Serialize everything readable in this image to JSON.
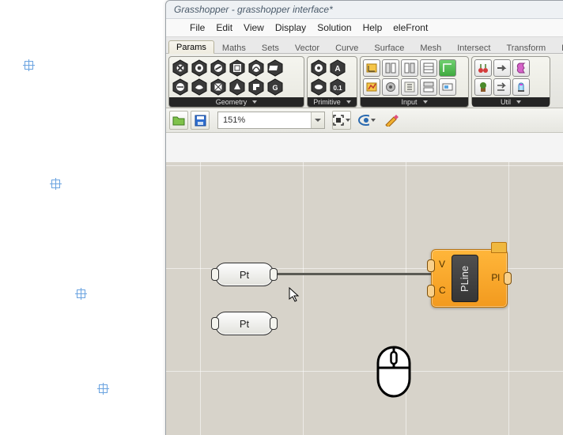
{
  "window": {
    "title": "Grasshopper - grasshopper interface*"
  },
  "menu": [
    "File",
    "Edit",
    "View",
    "Display",
    "Solution",
    "Help",
    "eleFront"
  ],
  "tabs": [
    "Params",
    "Maths",
    "Sets",
    "Vector",
    "Curve",
    "Surface",
    "Mesh",
    "Intersect",
    "Transform",
    "Displa"
  ],
  "ribbon": {
    "panels": [
      "Geometry",
      "Primitive",
      "Input",
      "Util"
    ]
  },
  "toolbar": {
    "zoom": "151%"
  },
  "canvas": {
    "nodes": [
      {
        "type": "param-point",
        "label": "Pt"
      },
      {
        "type": "param-point",
        "label": "Pt"
      },
      {
        "type": "component",
        "label": "PLine",
        "inputs": [
          "V",
          "C"
        ],
        "outputs": [
          "Pl"
        ]
      }
    ],
    "wires": [
      {
        "from": 0,
        "to": 2,
        "to_port": "V"
      }
    ]
  }
}
